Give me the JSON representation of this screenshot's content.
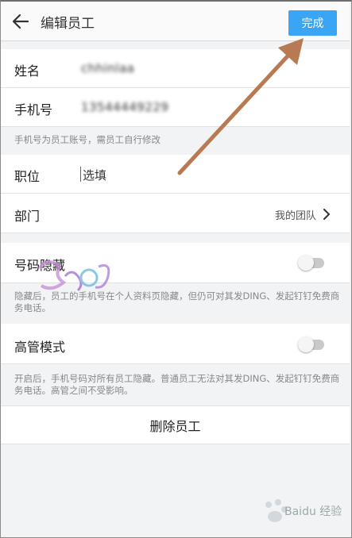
{
  "header": {
    "title": "编辑员工",
    "done_label": "完成"
  },
  "form": {
    "name_label": "姓名",
    "name_value": "chhinlaa",
    "phone_label": "手机号",
    "phone_value": "13544449229",
    "phone_hint": "手机号为员工账号，需员工自行修改",
    "position_label": "职位",
    "position_placeholder": "选填",
    "department_label": "部门",
    "department_value": "我的团队"
  },
  "privacy": {
    "hide_number_label": "号码隐藏",
    "hide_number_on": false,
    "hide_number_hint": "隐藏后，员工的手机号在个人资料页隐藏，但仍可对其发DING、发起钉钉免费商务电话。",
    "exec_mode_label": "高管模式",
    "exec_mode_on": false,
    "exec_mode_hint": "开启后，手机号码对所有员工隐藏。普通员工无法对其发DING、发起钉钉免费商务电话。高管之间不受影响。"
  },
  "actions": {
    "delete_label": "删除员工"
  },
  "watermark": {
    "baidu_text": "Baidu 经验"
  },
  "colors": {
    "accent": "#3aa4f5",
    "annotation_arrow": "#b87a52"
  }
}
